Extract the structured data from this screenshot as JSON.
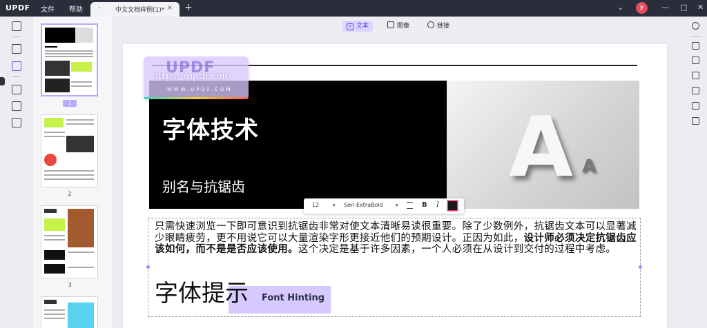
{
  "app": {
    "logo": "UPDF",
    "menu": [
      "文件",
      "帮助"
    ],
    "tab_title": "中文文档样例(1)*",
    "tab_minus": "-",
    "tab_close": "×",
    "tab_add": "+",
    "avatar_letter": "y",
    "window_controls": [
      "⌄",
      "—",
      "□",
      "✕"
    ]
  },
  "toolbar": {
    "modes": [
      {
        "label": "文本",
        "icon": "text-box-icon",
        "active": true
      },
      {
        "label": "图像",
        "icon": "image-icon",
        "active": false
      },
      {
        "label": "链接",
        "icon": "link-icon",
        "active": false
      }
    ]
  },
  "thumbnails": [
    {
      "page": "1",
      "selected": true
    },
    {
      "page": "2",
      "selected": false
    },
    {
      "page": "3",
      "selected": false
    }
  ],
  "document": {
    "hero_title": "字体技术",
    "hero_subtitle": "别名与抗锯齿",
    "hero_letter_big": "A",
    "hero_letter_small": "A",
    "paragraph_1": "只需快速浏览一下即可意识到抗锯齿非常对使文本清晰易读很重要。除了少数例外，抗锯齿文本可以显著减少眼睛疲劳，更不用说它可以大量渲染字形更接近他们的预期设计。正因为如此，",
    "paragraph_bold": "设计师必须决定抗锯齿应该如何，而不是是否应该使用。",
    "paragraph_2": "这个决定是基于许多因素，一个人必须在从设计到交付的过程中考虑。",
    "heading": "字体提示",
    "heading_en": "Font Hinting"
  },
  "watermark": {
    "logo": "UPDF",
    "url": "https://updf.com",
    "small": "WWW.UPDF.COM"
  },
  "format_bar": {
    "font_size": "12",
    "font_name": "Sen-ExtraBold",
    "bold": "B",
    "italic": "I",
    "dropdown_arrow": "▾",
    "color": "#1a1a1a"
  },
  "colors": {
    "accent": "#6b4df0",
    "accent_light": "#ddd5ff",
    "lime": "#c6f24a",
    "titlebar": "#2b2d3a"
  }
}
